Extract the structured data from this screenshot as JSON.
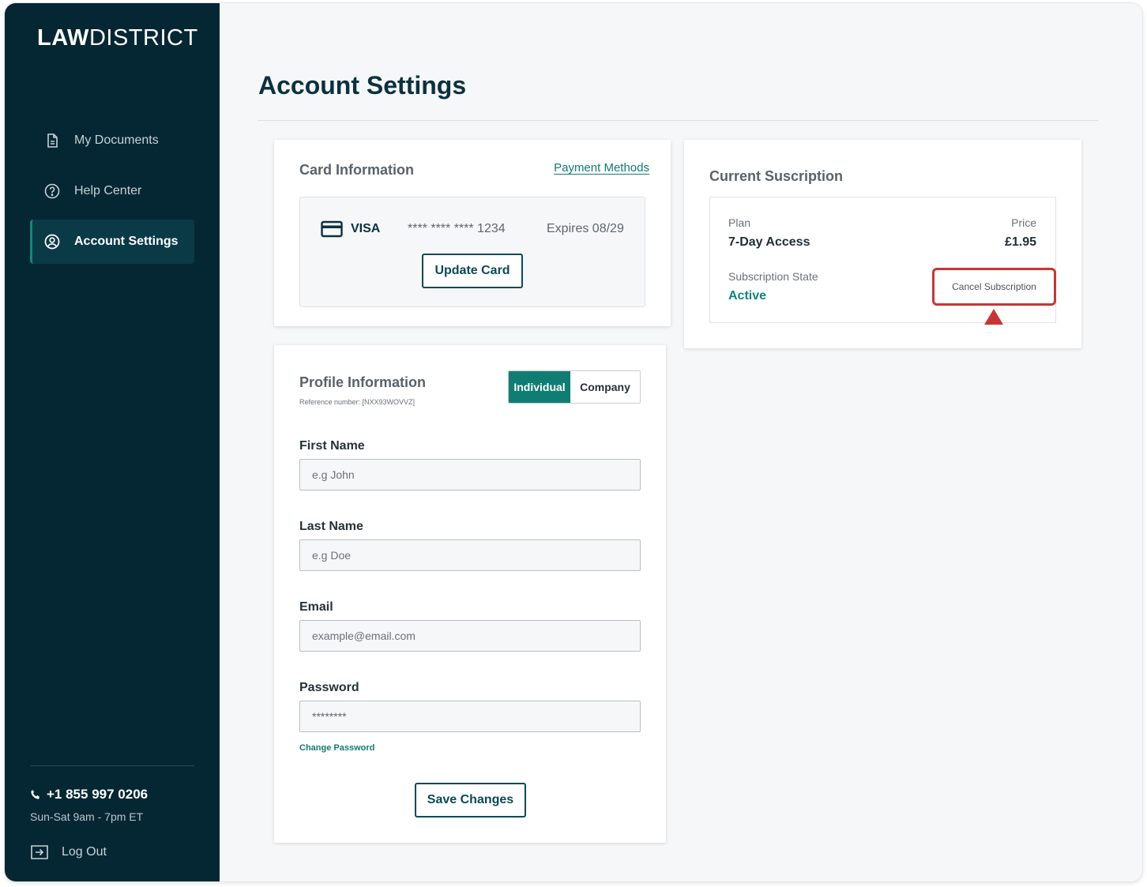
{
  "brand": {
    "logo_bold": "LAW",
    "logo_light": "DISTRICT"
  },
  "sidebar": {
    "items": [
      {
        "label": "My Documents",
        "icon": "document-icon",
        "active": false
      },
      {
        "label": "Help Center",
        "icon": "question-circle-icon",
        "active": false
      },
      {
        "label": "Account Settings",
        "icon": "user-circle-icon",
        "active": true
      }
    ],
    "phone": "+1 855 997 0206",
    "hours": "Sun-Sat 9am - 7pm ET",
    "logout_label": "Log Out"
  },
  "page": {
    "title": "Account Settings"
  },
  "card_info": {
    "heading": "Card Information",
    "payment_methods_link": "Payment Methods",
    "brand": "VISA",
    "masked_number": "**** **** **** 1234",
    "expires": "Expires 08/29",
    "update_button": "Update Card"
  },
  "subscription": {
    "heading": "Current Suscription",
    "plan_label": "Plan",
    "plan_value": "7-Day Access",
    "price_label": "Price",
    "price_value": "£1.95",
    "state_label": "Subscription State",
    "state_value": "Active",
    "cancel_button": "Cancel Subscription"
  },
  "profile": {
    "heading": "Profile Information",
    "reference": "Reference number: [NXX93WOVVZ]",
    "toggle": {
      "selected": "Individual",
      "other": "Company"
    },
    "fields": {
      "first_name": {
        "label": "First Name",
        "placeholder": "e.g John"
      },
      "last_name": {
        "label": "Last Name",
        "placeholder": "e.g Doe"
      },
      "email": {
        "label": "Email",
        "placeholder": "example@email.com"
      },
      "password": {
        "label": "Password",
        "value": "********"
      }
    },
    "change_password_link": "Change Password",
    "save_button": "Save Changes"
  },
  "colors": {
    "sidebar_bg": "#052733",
    "accent": "#107d72",
    "highlight": "#c93535",
    "title": "#0b3140"
  }
}
